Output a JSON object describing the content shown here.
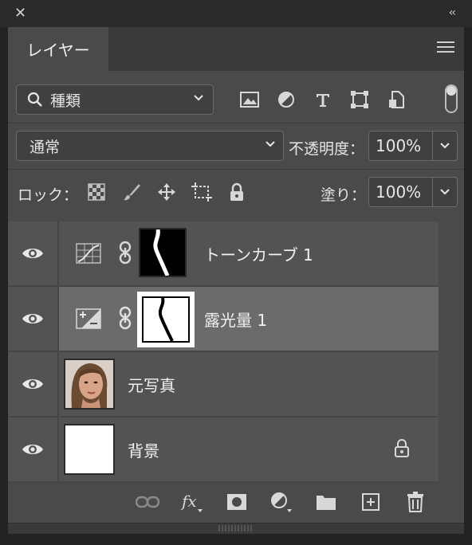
{
  "window": {
    "close_glyph": "✕",
    "collapse_glyph": "‹‹"
  },
  "panel": {
    "tab_label": "レイヤー"
  },
  "filter": {
    "kind_label": "種類",
    "icons": [
      "image-filter-icon",
      "adjustment-filter-icon",
      "type-filter-icon",
      "shape-filter-icon",
      "smartobject-filter-icon"
    ]
  },
  "blend": {
    "mode": "通常",
    "opacity_label": "不透明度：",
    "opacity_value": "100%"
  },
  "lock": {
    "label": "ロック：",
    "icons": [
      "lock-transparent-icon",
      "lock-image-icon",
      "lock-position-icon",
      "lock-artboard-icon",
      "lock-all-icon"
    ],
    "fill_label": "塗り：",
    "fill_value": "100%"
  },
  "layers": [
    {
      "name": "トーンカーブ 1",
      "type": "curves-adjustment",
      "visible": true,
      "selected": false
    },
    {
      "name": "露光量 1",
      "type": "exposure-adjustment",
      "visible": true,
      "selected": true
    },
    {
      "name": "元写真",
      "type": "image",
      "visible": true,
      "selected": false
    },
    {
      "name": "背景",
      "type": "background",
      "visible": true,
      "selected": false,
      "locked": true
    }
  ],
  "bottom_icons": [
    "link-layers-icon",
    "fx-icon",
    "add-mask-icon",
    "new-adjustment-icon",
    "new-group-icon",
    "new-layer-icon",
    "delete-icon"
  ],
  "colors": {
    "panel": "#4a4a4a",
    "selected_row": "#6b6b6b",
    "text": "#f2f2f2"
  }
}
